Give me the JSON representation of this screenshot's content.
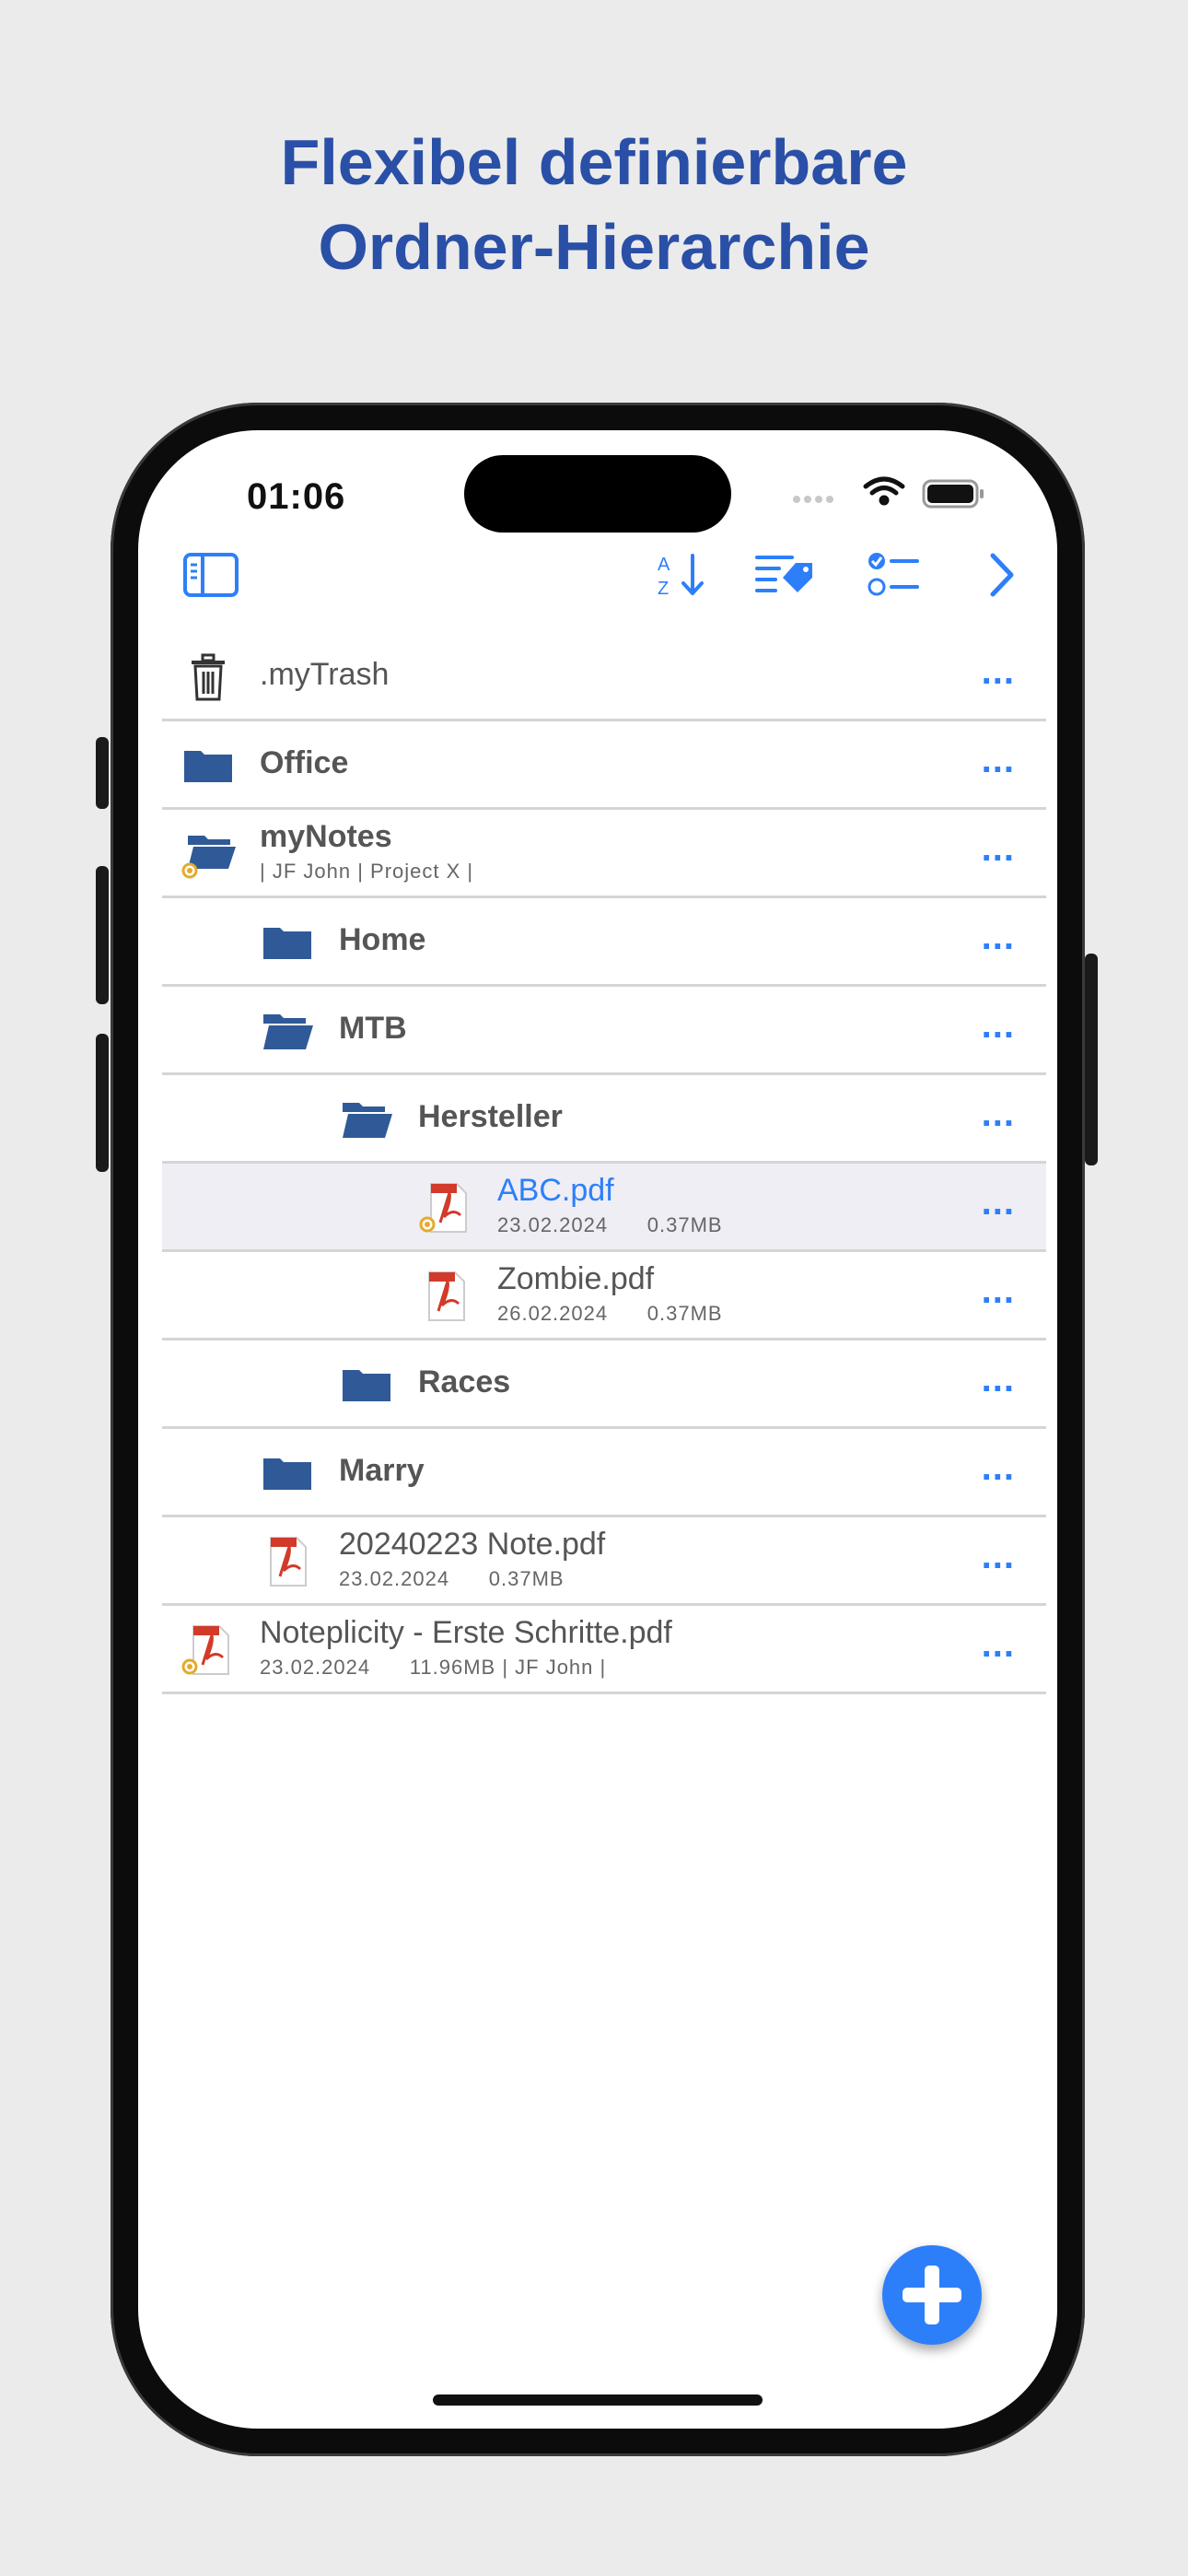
{
  "headline": {
    "line1": "Flexibel definierbare",
    "line2": "Ordner-Hierarchie"
  },
  "status_bar": {
    "time": "01:06",
    "icons": [
      "signal-dots-icon",
      "wifi-icon",
      "battery-icon"
    ]
  },
  "toolbar": {
    "icons": [
      "sidebar-toggle-icon",
      "sort-az-icon",
      "tag-filter-icon",
      "checklist-icon",
      "chevron-right-icon"
    ]
  },
  "colors": {
    "accent": "#2d7ff9",
    "headline": "#2a4fa7",
    "folder": "#2f5a97"
  },
  "items": [
    {
      "type": "trash",
      "name": ".myTrash",
      "meta": "",
      "more": "...",
      "level": 0
    },
    {
      "type": "folder",
      "name": "Office",
      "meta": "",
      "more": "...",
      "level": 0
    },
    {
      "type": "folder-open-shared",
      "name": "myNotes",
      "meta": "| JF John | Project X |",
      "more": "...",
      "level": 0
    },
    {
      "type": "folder",
      "name": "Home",
      "meta": "",
      "more": "...",
      "level": 1
    },
    {
      "type": "folder-open",
      "name": "MTB",
      "meta": "",
      "more": "...",
      "level": 1
    },
    {
      "type": "folder-open",
      "name": "Hersteller",
      "meta": "",
      "more": "...",
      "level": 2
    },
    {
      "type": "pdf-shared",
      "name": "ABC.pdf",
      "meta": "23.02.2024      0.37MB",
      "more": "...",
      "level": 3,
      "selected": true
    },
    {
      "type": "pdf",
      "name": "Zombie.pdf",
      "meta": "26.02.2024      0.37MB",
      "more": "...",
      "level": 3
    },
    {
      "type": "folder",
      "name": "Races",
      "meta": "",
      "more": "...",
      "level": 2
    },
    {
      "type": "folder",
      "name": "Marry",
      "meta": "",
      "more": "...",
      "level": 1
    },
    {
      "type": "pdf",
      "name": "20240223 Note.pdf",
      "meta": "23.02.2024      0.37MB",
      "more": "...",
      "level": 1
    },
    {
      "type": "pdf-shared",
      "name": "Noteplicity - Erste Schritte.pdf",
      "meta": "23.02.2024      11.96MB | JF John |",
      "more": "...",
      "level": 0
    }
  ],
  "fab": {
    "icon": "plus-icon"
  }
}
